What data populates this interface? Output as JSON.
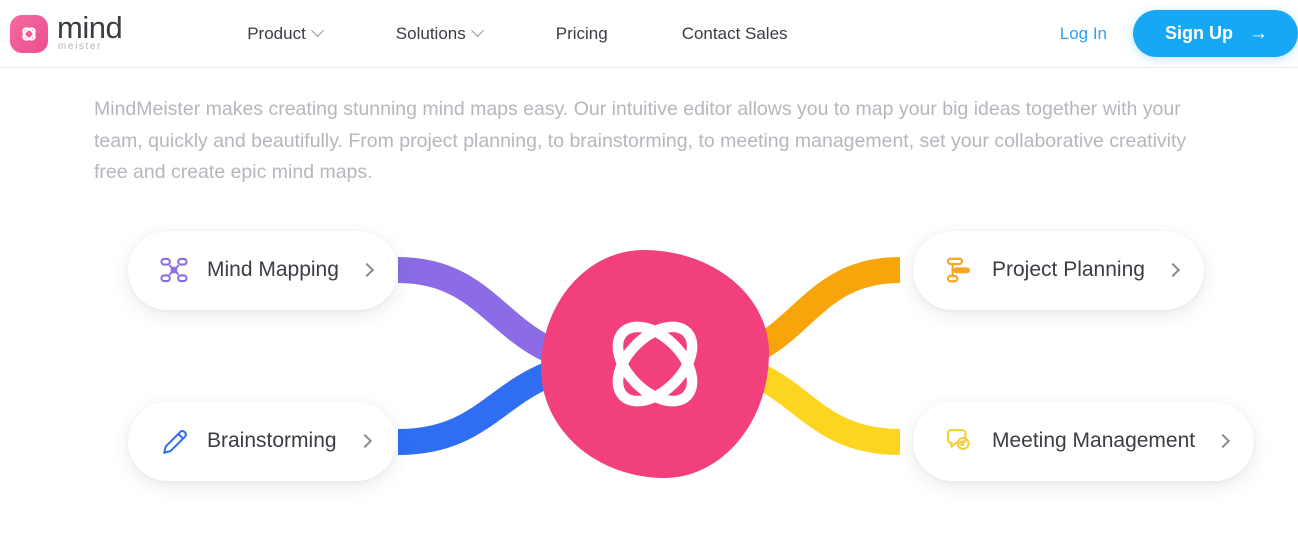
{
  "header": {
    "logo": {
      "mark_icon": "mindmeister-atom-icon",
      "primary": "mind",
      "secondary": "meister",
      "brand_color": "#ee4e8d"
    },
    "nav": [
      {
        "label": "Product",
        "has_dropdown": true
      },
      {
        "label": "Solutions",
        "has_dropdown": true
      },
      {
        "label": "Pricing",
        "has_dropdown": false
      },
      {
        "label": "Contact Sales",
        "has_dropdown": false
      }
    ],
    "login_label": "Log In",
    "signup_label": "Sign Up",
    "signup_arrow": "→",
    "signup_color": "#17a8f5",
    "login_color": "#2ea3f2"
  },
  "intro": {
    "paragraph": "MindMeister makes creating stunning mind maps easy. Our intuitive editor allows you to map your big ideas together with your team, quickly and beautifully. From project planning, to brainstorming, to meeting management, set your collaborative creativity free and create epic mind maps."
  },
  "mindmap": {
    "center": {
      "icon": "mindmeister-atom-icon",
      "color": "#f2407d"
    },
    "branches": [
      {
        "id": "mind-mapping",
        "label": "Mind Mapping",
        "icon": "mind-map-nodes-icon",
        "color": "#8b6ce6",
        "side": "left",
        "position": "top"
      },
      {
        "id": "brainstorming",
        "label": "Brainstorming",
        "icon": "pencil-icon",
        "color": "#2f6ef0",
        "side": "left",
        "position": "bottom"
      },
      {
        "id": "project-planning",
        "label": "Project Planning",
        "icon": "gantt-bars-icon",
        "color": "#f5a623",
        "side": "right",
        "position": "top"
      },
      {
        "id": "meeting-management",
        "label": "Meeting Management",
        "icon": "chat-bubbles-icon",
        "color": "#f5d33a",
        "side": "right",
        "position": "bottom"
      }
    ],
    "chevron": "›"
  }
}
